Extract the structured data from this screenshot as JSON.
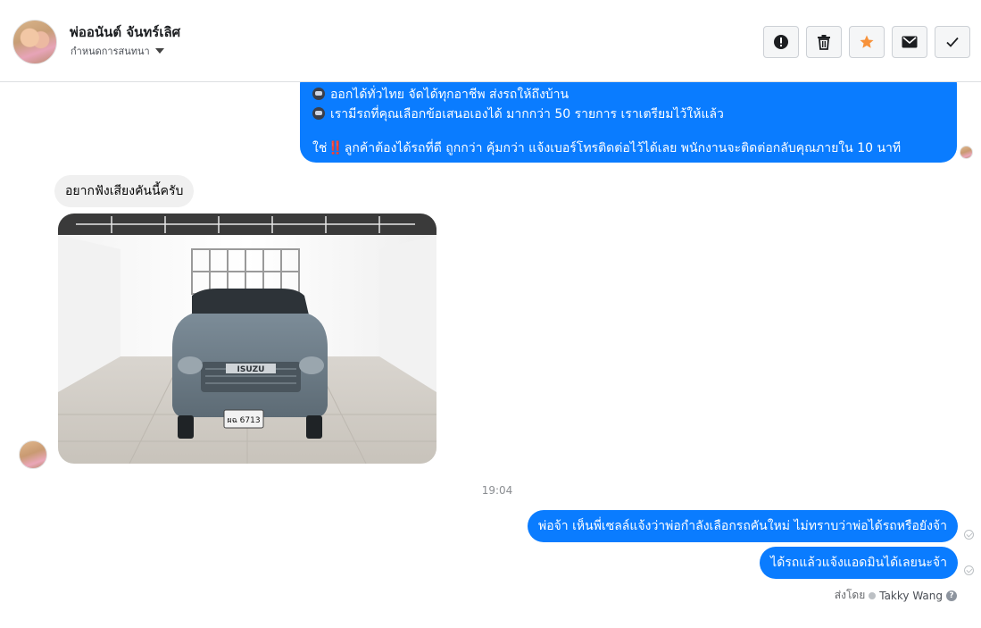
{
  "header": {
    "name": "พ่ออนันต์ จันทร์เลิศ",
    "subtitle": "กำหนดการสนทนา",
    "actions": [
      {
        "icon": "alert-icon"
      },
      {
        "icon": "trash-icon"
      },
      {
        "icon": "star-icon",
        "color": "#f7923b"
      },
      {
        "icon": "mail-icon"
      },
      {
        "icon": "check-icon"
      }
    ]
  },
  "messages": {
    "outgoing_block": {
      "line1": "ออกได้ทั่วไทย จัดได้ทุกอาชีพ ส่งรถให้ถึงบ้าน",
      "line2": "เรามีรถที่คุณเลือกข้อเสนอเองได้ มากกว่า 50 รายการ เราเตรียมไว้ให้แล้ว",
      "line3_prefix": "ใช่",
      "line3_bang": "‼️",
      "line3_rest": "ลูกค้าต้องได้รถที่ดี ถูกกว่า คุ้มกว่า แจ้งเบอร์โทรติดต่อไว้ได้เลย พนักงานจะติดต่อกลับคุณภายใน 10 นาที"
    },
    "incoming_text": "อยากฟังเสียงคันนี้ครับ",
    "incoming_photo": {
      "plate": "ผฉ 6713",
      "brand": "ISUZU"
    },
    "timestamp": "19:04",
    "reply1": "พ่อจ้า เห็นพี่เซลล์แจ้งว่าพ่อกำลังเลือกรถคันใหม่ ไม่ทราบว่าพ่อได้รถหรือยังจ้า",
    "reply2": "ได้รถแล้วแจ้งแอดมินได้เลยนะจ้า",
    "sent_by_label": "ส่งโดย",
    "sent_by_name": "Takky Wang"
  },
  "colors": {
    "outgoing": "#0a7cff",
    "incoming": "#f0f0f0",
    "star": "#f7923b"
  }
}
